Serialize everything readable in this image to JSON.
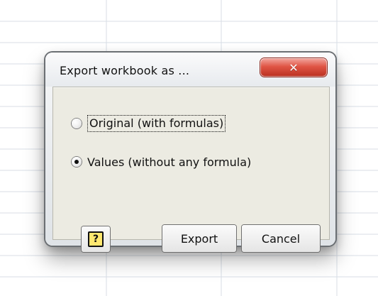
{
  "dialog": {
    "title": "Export workbook as ...",
    "close_icon": "close-icon",
    "options": [
      {
        "label": "Original (with formulas)",
        "selected": false
      },
      {
        "label": "Values (without any formula)",
        "selected": true
      }
    ],
    "buttons": {
      "export_label": "Export",
      "cancel_label": "Cancel",
      "help_icon": "help-icon"
    }
  },
  "colors": {
    "dialog_bg": "#ECEBE2",
    "close_red": "#E05545",
    "help_yellow": "#FFE870"
  }
}
